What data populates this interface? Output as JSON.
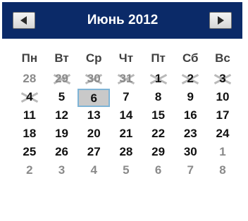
{
  "header": {
    "title": "Июнь 2012"
  },
  "weekdays": [
    "Пн",
    "Вт",
    "Ср",
    "Чт",
    "Пт",
    "Сб",
    "Вс"
  ],
  "weeks": [
    [
      {
        "d": "28",
        "o": true,
        "x": false
      },
      {
        "d": "29",
        "o": true,
        "x": true
      },
      {
        "d": "30",
        "o": true,
        "x": true
      },
      {
        "d": "31",
        "o": true,
        "x": true
      },
      {
        "d": "1",
        "o": false,
        "x": true
      },
      {
        "d": "2",
        "o": false,
        "x": true
      },
      {
        "d": "3",
        "o": false,
        "x": true
      }
    ],
    [
      {
        "d": "4",
        "o": false,
        "x": true
      },
      {
        "d": "5",
        "o": false,
        "x": false
      },
      {
        "d": "6",
        "o": false,
        "x": false,
        "today": true
      },
      {
        "d": "7",
        "o": false,
        "x": false
      },
      {
        "d": "8",
        "o": false,
        "x": false
      },
      {
        "d": "9",
        "o": false,
        "x": false
      },
      {
        "d": "10",
        "o": false,
        "x": false
      }
    ],
    [
      {
        "d": "11",
        "o": false,
        "x": false
      },
      {
        "d": "12",
        "o": false,
        "x": false
      },
      {
        "d": "13",
        "o": false,
        "x": false
      },
      {
        "d": "14",
        "o": false,
        "x": false
      },
      {
        "d": "15",
        "o": false,
        "x": false
      },
      {
        "d": "16",
        "o": false,
        "x": false
      },
      {
        "d": "17",
        "o": false,
        "x": false
      }
    ],
    [
      {
        "d": "18",
        "o": false,
        "x": false
      },
      {
        "d": "19",
        "o": false,
        "x": false
      },
      {
        "d": "20",
        "o": false,
        "x": false
      },
      {
        "d": "21",
        "o": false,
        "x": false
      },
      {
        "d": "22",
        "o": false,
        "x": false
      },
      {
        "d": "23",
        "o": false,
        "x": false
      },
      {
        "d": "24",
        "o": false,
        "x": false
      }
    ],
    [
      {
        "d": "25",
        "o": false,
        "x": false
      },
      {
        "d": "26",
        "o": false,
        "x": false
      },
      {
        "d": "27",
        "o": false,
        "x": false
      },
      {
        "d": "28",
        "o": false,
        "x": false
      },
      {
        "d": "29",
        "o": false,
        "x": false
      },
      {
        "d": "30",
        "o": false,
        "x": false
      },
      {
        "d": "1",
        "o": true,
        "x": false
      }
    ],
    [
      {
        "d": "2",
        "o": true,
        "x": false
      },
      {
        "d": "3",
        "o": true,
        "x": false
      },
      {
        "d": "4",
        "o": true,
        "x": false
      },
      {
        "d": "5",
        "o": true,
        "x": false
      },
      {
        "d": "6",
        "o": true,
        "x": false
      },
      {
        "d": "7",
        "o": true,
        "x": false
      },
      {
        "d": "8",
        "o": true,
        "x": false
      }
    ]
  ],
  "colors": {
    "header_bg": "#0b2a68",
    "today_border": "#7eb4d6",
    "today_bg": "#c9c9c9",
    "other_month_text": "#8a8a8a"
  },
  "icons": {
    "prev": "triangle-left-icon",
    "next": "triangle-right-icon"
  }
}
